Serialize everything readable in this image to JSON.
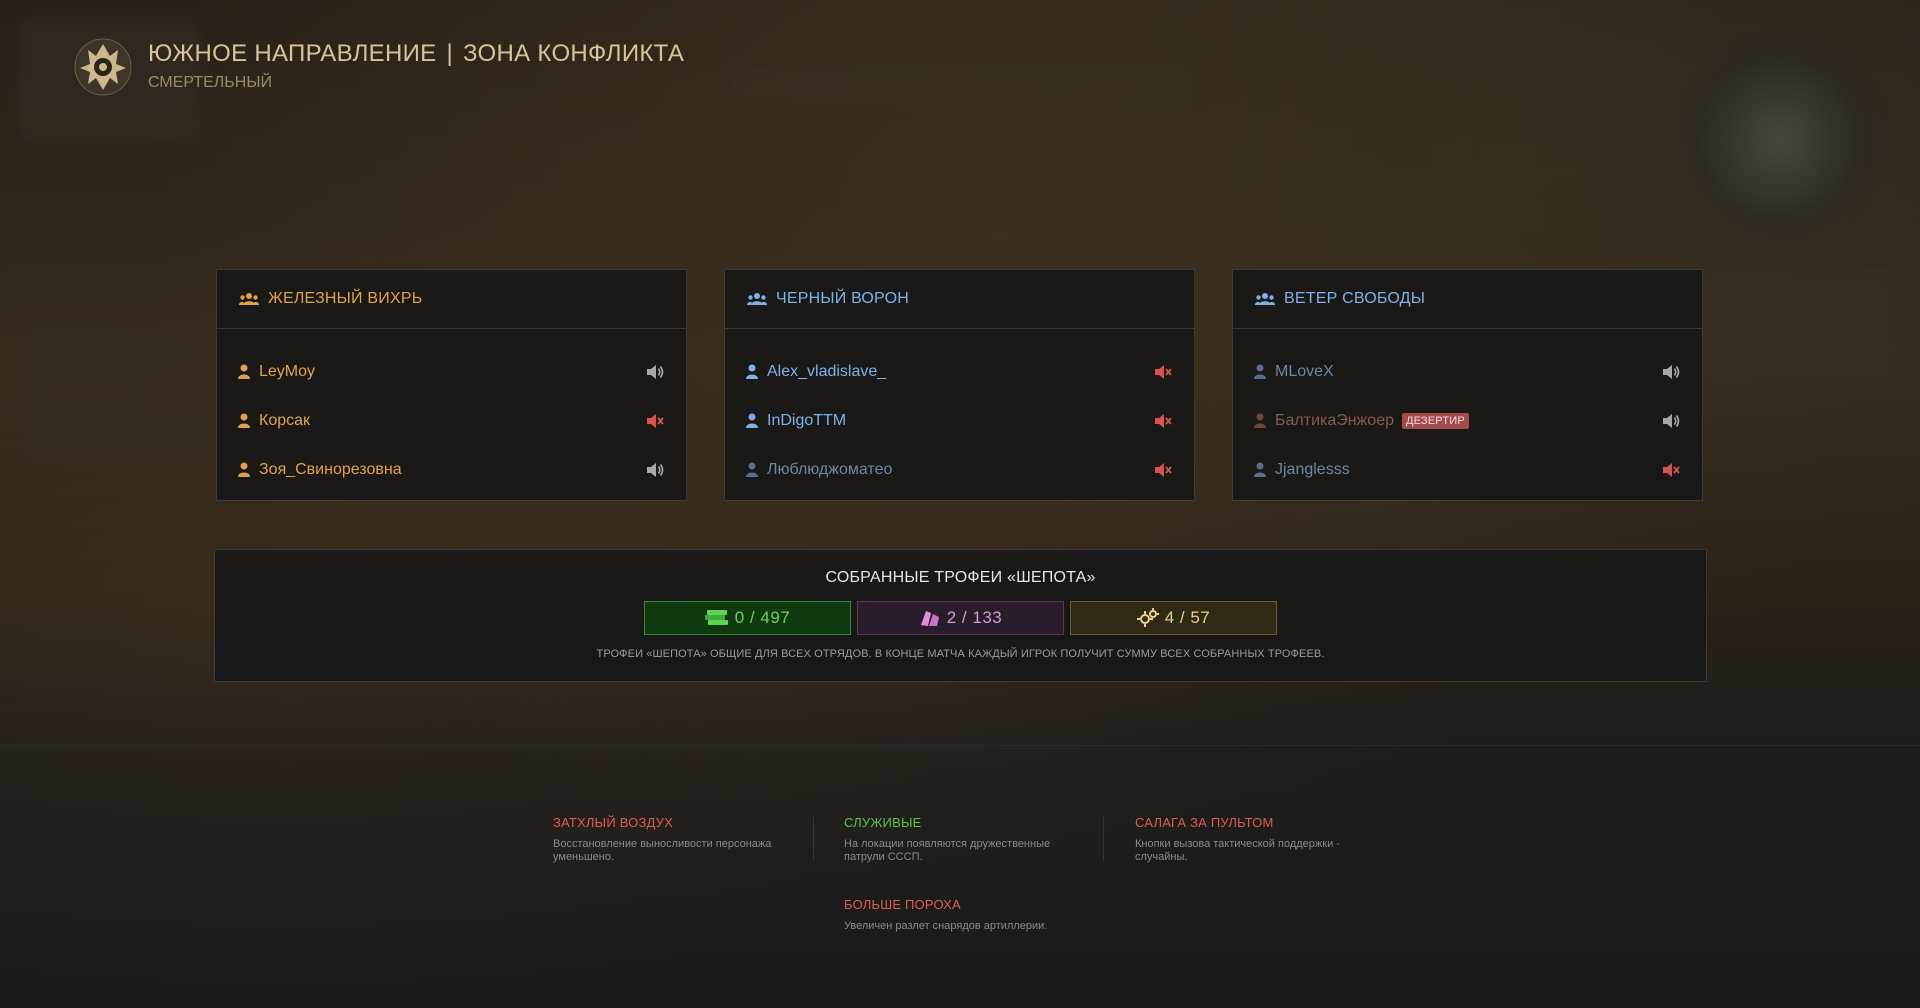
{
  "header": {
    "title_left": "ЮЖНОЕ НАПРАВЛЕНИЕ",
    "title_separator": "|",
    "title_right": "ЗОНА КОНФЛИКТА",
    "subtitle": "СМЕРТЕЛЬНЫЙ"
  },
  "squads": [
    {
      "name": "ЖЕЛЕЗНЫЙ ВИХРЬ",
      "players": [
        {
          "name": "LeyMoy",
          "muted": false
        },
        {
          "name": "Корсак",
          "muted": true
        },
        {
          "name": "Зоя_Свинорезовна",
          "muted": false
        }
      ]
    },
    {
      "name": "ЧЕРНЫЙ ВОРОН",
      "players": [
        {
          "name": "Alex_vladislave_",
          "muted": true
        },
        {
          "name": "InDigoTTM",
          "muted": true
        },
        {
          "name": "Люблюджоматео",
          "muted": true
        }
      ]
    },
    {
      "name": "ВЕТЕР СВОБОДЫ",
      "players": [
        {
          "name": "MLoveX",
          "muted": false
        },
        {
          "name": "БалтикаЭнжоер",
          "muted": false,
          "badge": "ДЕЗЕРТИР"
        },
        {
          "name": "Jjanglesss",
          "muted": true
        }
      ]
    }
  ],
  "trophies": {
    "title": "СОБРАННЫЕ ТРОФЕИ «ШЕПОТА»",
    "items": [
      {
        "icon": "cash-stack-icon",
        "value": "0 / 497",
        "color": "#6ad35e"
      },
      {
        "icon": "plates-icon",
        "value": "2 / 133",
        "color": "#d79ad3"
      },
      {
        "icon": "gears-icon",
        "value": "4 / 57",
        "color": "#e5d08d"
      }
    ],
    "note": "ТРОФЕИ «ШЕПОТА» ОБЩИЕ ДЛЯ ВСЕХ ОТРЯДОВ. В КОНЦЕ МАТЧА КАЖДЫЙ ИГРОК ПОЛУЧИТ СУММУ ВСЕХ СОБРАННЫХ ТРОФЕЕВ."
  },
  "modifiers": [
    {
      "title": "ЗАТХЛЫЙ ВОЗДУХ",
      "desc": "Восстановление выносливости персонажа уменьшено.",
      "color": "#e05a52"
    },
    {
      "title": "СЛУЖИВЫЕ",
      "desc": "На локации появляются дружественные патрули СССП.",
      "color": "#59c34f"
    },
    {
      "title": "САЛАГА ЗА ПУЛЬТОМ",
      "desc": "Кнопки вызова тактической поддержки - случайны.",
      "color": "#e05a52"
    },
    {
      "title": "БОЛЬШЕ ПОРОХА",
      "desc": "Увеличен разлет снарядов артиллерии.",
      "color": "#e05a52"
    }
  ],
  "colors": {
    "squad1": "#e2a14f",
    "squad2": "#7fb1e8",
    "squad3": "#7fb1e8",
    "muted_speaker": "#d95252",
    "speaker": "#a8a8a8"
  }
}
